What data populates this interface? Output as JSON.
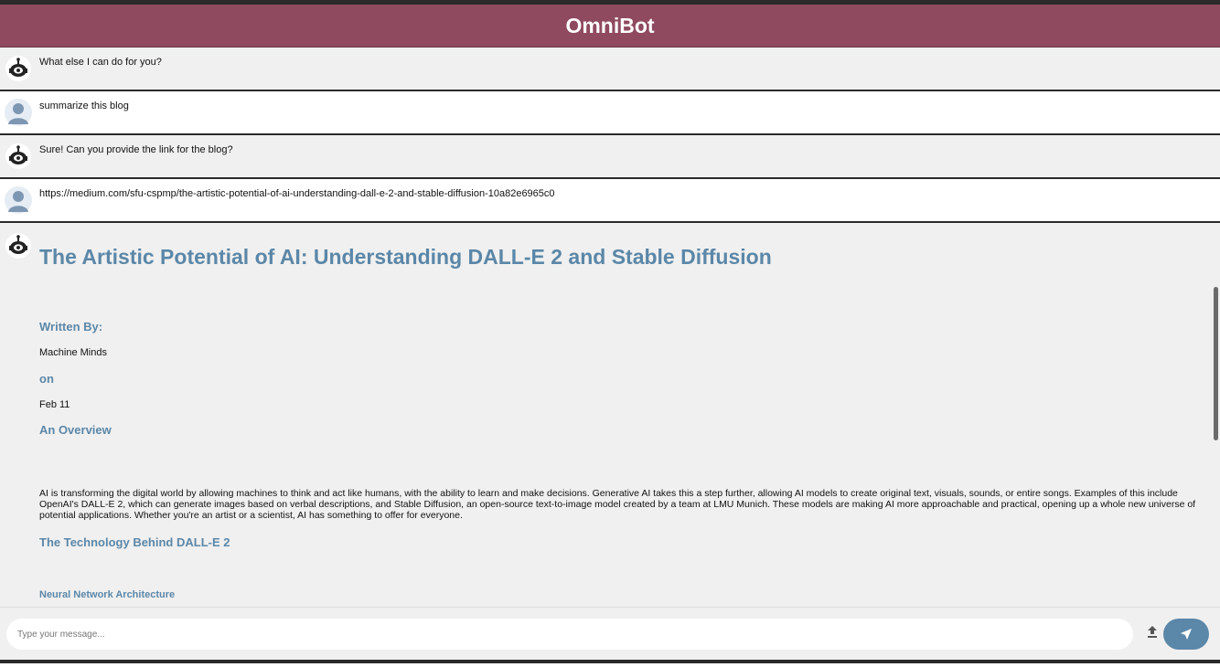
{
  "app": {
    "title": "OmniBot"
  },
  "messages": [
    {
      "role": "bot",
      "text": "What else I can do for you?"
    },
    {
      "role": "user",
      "text": "summarize this blog"
    },
    {
      "role": "bot",
      "text": "Sure! Can you provide the link for the blog?"
    },
    {
      "role": "user",
      "text": "https://medium.com/sfu-cspmp/the-artistic-potential-of-ai-understanding-dall-e-2-and-stable-diffusion-10a82e6965c0"
    }
  ],
  "blog": {
    "title": "The Artistic Potential of AI: Understanding DALL-E 2 and Stable Diffusion",
    "written_by_label": "Written By:",
    "author": "Machine Minds",
    "on_label": "on",
    "date": "Feb 11",
    "overview_heading": "An Overview",
    "overview_text": "AI is transforming the digital world by allowing machines to think and act like humans, with the ability to learn and make decisions. Generative AI takes this a step further, allowing AI models to create original text, visuals, sounds, or entire songs. Examples of this include OpenAI's DALL-E 2, which can generate images based on verbal descriptions, and Stable Diffusion, an open-source text-to-image model created by a team at LMU Munich. These models are making AI more approachable and practical, opening up a whole new universe of potential applications. Whether you're an artist or a scientist, AI has something to offer for everyone.",
    "tech_heading": "The Technology Behind DALL-E 2",
    "nn_heading": "Neural Network Architecture"
  },
  "input": {
    "placeholder": "Type your message..."
  },
  "icons": {
    "bot": "robot-icon",
    "user": "user-avatar-icon",
    "upload": "upload-icon",
    "send": "send-icon"
  },
  "colors": {
    "header": "#8f4a5f",
    "accent": "#5b87a8",
    "bot_bg": "#f0f0f0",
    "user_bg": "#ffffff"
  }
}
